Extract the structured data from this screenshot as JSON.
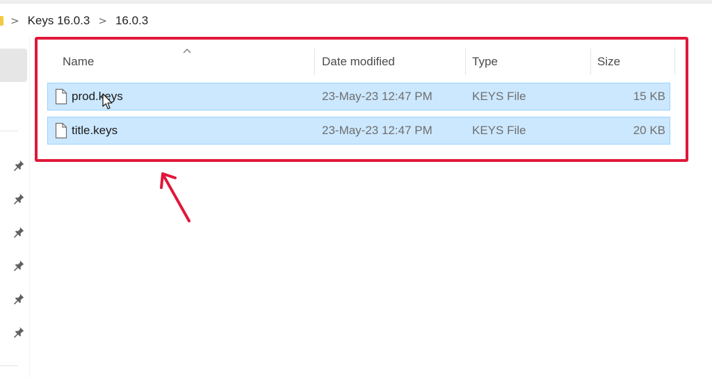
{
  "breadcrumb": {
    "items": [
      "Keys 16.0.3",
      "16.0.3"
    ],
    "separator": ">"
  },
  "columns": {
    "name": "Name",
    "date_modified": "Date modified",
    "type": "Type",
    "size": "Size"
  },
  "files": [
    {
      "name": "prod.keys",
      "date_modified": "23-May-23 12:47 PM",
      "type": "KEYS File",
      "size": "15 KB",
      "icon": "file-icon",
      "selected": true
    },
    {
      "name": "title.keys",
      "date_modified": "23-May-23 12:47 PM",
      "type": "KEYS File",
      "size": "20 KB",
      "icon": "file-icon",
      "selected": true
    }
  ],
  "nav_pane": {
    "pinned_icon": "pin-icon",
    "pinned_count": 6
  },
  "annotation": {
    "highlight_color": "#e0173a",
    "arrow_icon": "annotation-arrow-icon"
  },
  "colors": {
    "selection_fill": "#cce8ff",
    "selection_border": "#99d1ff",
    "folder": "#f5c842"
  }
}
